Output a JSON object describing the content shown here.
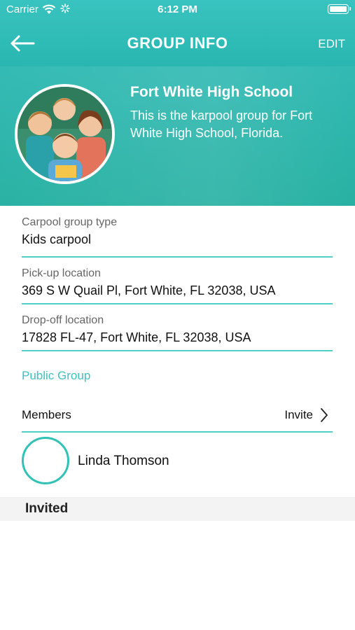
{
  "status_bar": {
    "carrier": "Carrier",
    "time": "6:12 PM"
  },
  "nav": {
    "title": "GROUP INFO",
    "edit_label": "EDIT"
  },
  "group": {
    "name": "Fort White High School",
    "description": "This is the karpool group for Fort White High School, Florida."
  },
  "fields": {
    "type_label": "Carpool group type",
    "type_value": "Kids carpool",
    "pickup_label": "Pick-up location",
    "pickup_value": "369 S W Quail Pl, Fort White, FL 32038, USA",
    "dropoff_label": "Drop-off location",
    "dropoff_value": "17828 FL-47, Fort White, FL 32038, USA"
  },
  "public_label": "Public Group",
  "members": {
    "label": "Members",
    "invite_label": "Invite",
    "items": [
      {
        "name": "Linda Thomson"
      }
    ]
  },
  "invited": {
    "title": "Invited"
  },
  "colors": {
    "accent": "#3fc1bd",
    "header_top": "#39c3c0",
    "header_bottom": "#1fae9f",
    "divider": "#4fcfc8"
  }
}
